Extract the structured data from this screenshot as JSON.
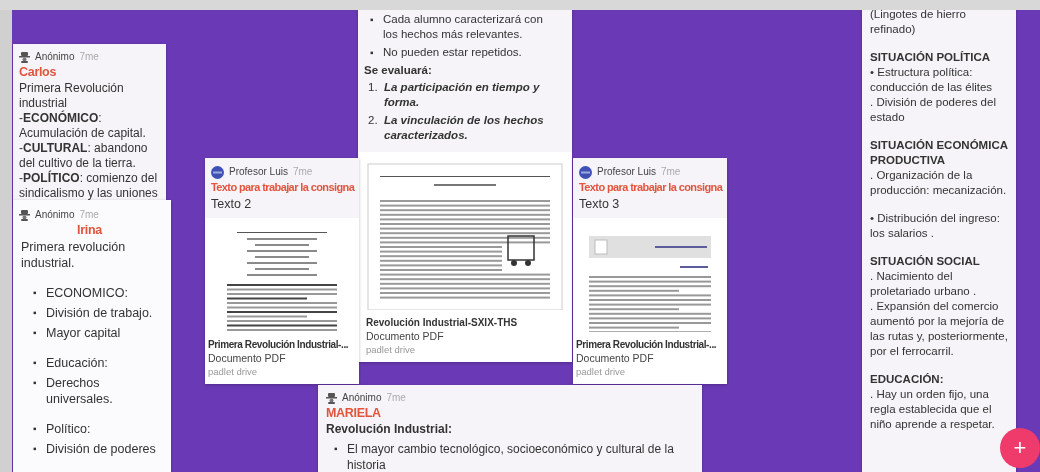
{
  "posts": [
    {
      "kind": "text",
      "author": "Anónimo",
      "avatar": {
        "kind": "anonymous"
      },
      "time": "7me",
      "subject": "Carlos",
      "paragraphs": [
        "Primera Revolución industrial",
        "-**ECONÓMICO**: Acumulación de capital.",
        "-**CULTURAL**: abandono del cultivo de la tierra.",
        "-**POLÍTICO**: comienzo del sindicalismo y las uniones"
      ]
    },
    {
      "kind": "list",
      "author": "Anónimo",
      "avatar": {
        "kind": "anonymous"
      },
      "time": "7me",
      "subject": "Irina",
      "body": "Primera revolución industrial.",
      "bullet_groups": [
        [
          {
            "marker": "▪",
            "text": "ECONOMICO:"
          },
          {
            "marker": "▪",
            "text": "División de trabajo."
          },
          {
            "marker": "▪",
            "text": "Mayor capital"
          }
        ],
        [
          {
            "marker": "▪",
            "text": "Educación:"
          },
          {
            "marker": "▪",
            "text": "Derechos universales."
          }
        ],
        [
          {
            "marker": "▪",
            "text": "Político:"
          },
          {
            "marker": "▪",
            "text": "División de poderes"
          }
        ]
      ]
    },
    {
      "kind": "assignment",
      "bullets": [
        {
          "marker": "▪",
          "text": "Cada alumno caracterizará con los hechos más relevantes."
        },
        {
          "marker": "▪",
          "text": "No pueden estar repetidos."
        }
      ],
      "heading": "Se evaluará:",
      "numbered": [
        {
          "marker": "1.",
          "text": "La participación en tiempo y forma."
        },
        {
          "marker": "2.",
          "text": "La vinculación de los hechos caracterizados."
        }
      ],
      "attachment": {
        "title": "Revolución Industrial-SXIX-THS",
        "type": "Documento PDF",
        "source": "padlet drive",
        "preview": {
          "kind": "article"
        }
      }
    },
    {
      "kind": "document",
      "author": "Profesor Luis",
      "avatar": {
        "kind": "teacher"
      },
      "time": "7me",
      "subject": "Texto para trabajar la consigna",
      "body": "Texto 2",
      "attachment": {
        "title": "Primera Revolución Industrial-...",
        "type": "Documento PDF",
        "source": "padlet drive",
        "preview": {
          "kind": "paper"
        }
      }
    },
    {
      "kind": "document",
      "author": "Profesor Luis",
      "avatar": {
        "kind": "teacher"
      },
      "time": "7me",
      "subject": "Texto para trabajar la consigna",
      "body": "Texto 3",
      "attachment": {
        "title": "Primera Revolución Industrial-...",
        "type": "Documento PDF",
        "source": "padlet drive",
        "preview": {
          "kind": "chapter"
        }
      }
    },
    {
      "kind": "list",
      "author": "Anónimo",
      "avatar": {
        "kind": "anonymous"
      },
      "time": "7me",
      "subject": "MARIELA",
      "heading": "Revolución Industrial:",
      "bullet_groups": [
        [
          {
            "marker": "▪",
            "text": "El mayor cambio tecnológico, socioeconómico y cultural de la historia"
          }
        ]
      ]
    },
    {
      "kind": "sections",
      "blocks": [
        {
          "kind": "text",
          "lines": [
            "(Lingotes de hierro refinado)"
          ]
        },
        {
          "kind": "heading",
          "lines": [
            "SITUACIÓN POLÍTICA"
          ]
        },
        {
          "kind": "text",
          "lines": [
            "• Estructura política: conducción de las élites",
            ". División de poderes del estado"
          ]
        },
        {
          "kind": "heading",
          "lines": [
            "SITUACIÓN ECONÓMICA PRODUCTIVA"
          ]
        },
        {
          "kind": "text",
          "lines": [
            ". Organización de la producción: mecanización."
          ]
        },
        {
          "kind": "text",
          "lines": [
            "• Distribución del ingreso: los salarios ."
          ]
        },
        {
          "kind": "heading",
          "lines": [
            "SITUACIÓN SOCIAL"
          ]
        },
        {
          "kind": "text",
          "lines": [
            ". Nacimiento del proletariado urbano .",
            ". Expansión del comercio aumentó por la mejoría de las rutas y, posteriormente, por el ferrocarril."
          ]
        },
        {
          "kind": "heading",
          "lines": [
            "EDUCACIÓN:"
          ]
        },
        {
          "kind": "text",
          "lines": [
            ". Hay un orden fijo, una regla establecida que el niño aprende a respetar."
          ]
        }
      ]
    }
  ],
  "add_button": {
    "label": "+"
  }
}
